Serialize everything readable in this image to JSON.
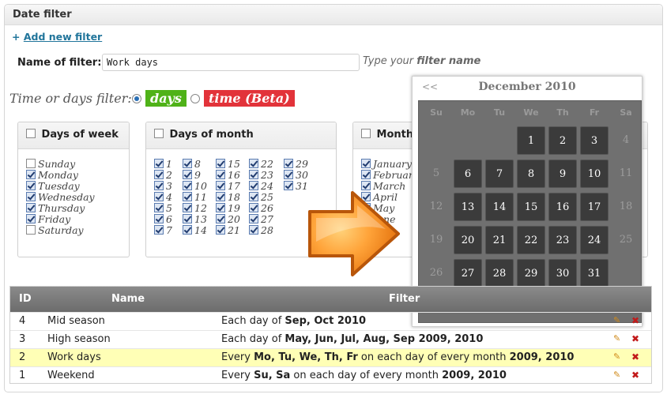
{
  "panel": {
    "title": "Date filter"
  },
  "add_new": {
    "prefix": "+",
    "label": "Add new filter"
  },
  "filter_name": {
    "label": "Name of filter:",
    "value": "Work days",
    "hint_prefix": "Type your",
    "hint_bold": "filter name"
  },
  "mode": {
    "label": "Time or days filter:",
    "days_label": "days",
    "time_label": "time (Beta)",
    "selected": "days",
    "colors": {
      "days": "#4fb218",
      "time": "#e2333a"
    }
  },
  "days_of_week": {
    "title": "Days of week",
    "items": [
      {
        "label": "Sunday",
        "checked": false
      },
      {
        "label": "Monday",
        "checked": true
      },
      {
        "label": "Tuesday",
        "checked": true
      },
      {
        "label": "Wednesday",
        "checked": true
      },
      {
        "label": "Thursday",
        "checked": true
      },
      {
        "label": "Friday",
        "checked": true
      },
      {
        "label": "Saturday",
        "checked": false
      }
    ]
  },
  "days_of_month": {
    "title": "Days of month",
    "columns": [
      [
        "1",
        "2",
        "3",
        "4",
        "5",
        "6",
        "7"
      ],
      [
        "8",
        "9",
        "10",
        "11",
        "12",
        "13",
        "14"
      ],
      [
        "15",
        "16",
        "17",
        "18",
        "19",
        "20",
        "21"
      ],
      [
        "22",
        "23",
        "24",
        "25",
        "26",
        "27",
        "28"
      ],
      [
        "29",
        "30",
        "31"
      ]
    ]
  },
  "months": {
    "title": "Months",
    "items": [
      {
        "label": "January",
        "checked": true
      },
      {
        "label": "February",
        "checked": true
      },
      {
        "label": "March",
        "checked": true
      },
      {
        "label": "April",
        "checked": true
      },
      {
        "label": "May",
        "checked": true
      },
      {
        "label": "June",
        "checked": true
      }
    ]
  },
  "calendar": {
    "prev": "<<",
    "title": "December 2010",
    "weekdays": [
      "Su",
      "Mo",
      "Tu",
      "We",
      "Th",
      "Fr",
      "Sa"
    ],
    "weeks": [
      [
        null,
        null,
        null,
        "1",
        "2",
        "3",
        "4"
      ],
      [
        "5",
        "6",
        "7",
        "8",
        "9",
        "10",
        "11"
      ],
      [
        "12",
        "13",
        "14",
        "15",
        "16",
        "17",
        "18"
      ],
      [
        "19",
        "20",
        "21",
        "22",
        "23",
        "24",
        "25"
      ],
      [
        "26",
        "27",
        "28",
        "29",
        "30",
        "31",
        null
      ]
    ],
    "highlighted_days": [
      "1",
      "2",
      "3",
      "6",
      "7",
      "8",
      "9",
      "10",
      "13",
      "14",
      "15",
      "16",
      "17",
      "20",
      "21",
      "22",
      "23",
      "24",
      "27",
      "28",
      "29",
      "30",
      "31"
    ]
  },
  "table": {
    "headers": {
      "id": "ID",
      "name": "Name",
      "filter": "Filter"
    },
    "rows": [
      {
        "id": "4",
        "name": "Mid season",
        "parts": [
          [
            "Each day of ",
            false
          ],
          [
            "Sep, Oct 2010",
            true
          ]
        ],
        "highlighted": false
      },
      {
        "id": "3",
        "name": "High season",
        "parts": [
          [
            "Each day of ",
            false
          ],
          [
            "May, Jun, Jul, Aug, Sep 2009, 2010",
            true
          ]
        ],
        "highlighted": false
      },
      {
        "id": "2",
        "name": "Work days",
        "parts": [
          [
            "Every ",
            false
          ],
          [
            "Mo, Tu, We, Th, Fr",
            true
          ],
          [
            " on each day of every month ",
            false
          ],
          [
            "2009, 2010",
            true
          ]
        ],
        "highlighted": true
      },
      {
        "id": "1",
        "name": "Weekend",
        "parts": [
          [
            "Every ",
            false
          ],
          [
            "Su, Sa",
            true
          ],
          [
            " on each day of every month ",
            false
          ],
          [
            "2009, 2010",
            true
          ]
        ],
        "highlighted": false
      }
    ],
    "edit_icon": "pencil-icon",
    "delete_icon": "delete-x-icon"
  }
}
